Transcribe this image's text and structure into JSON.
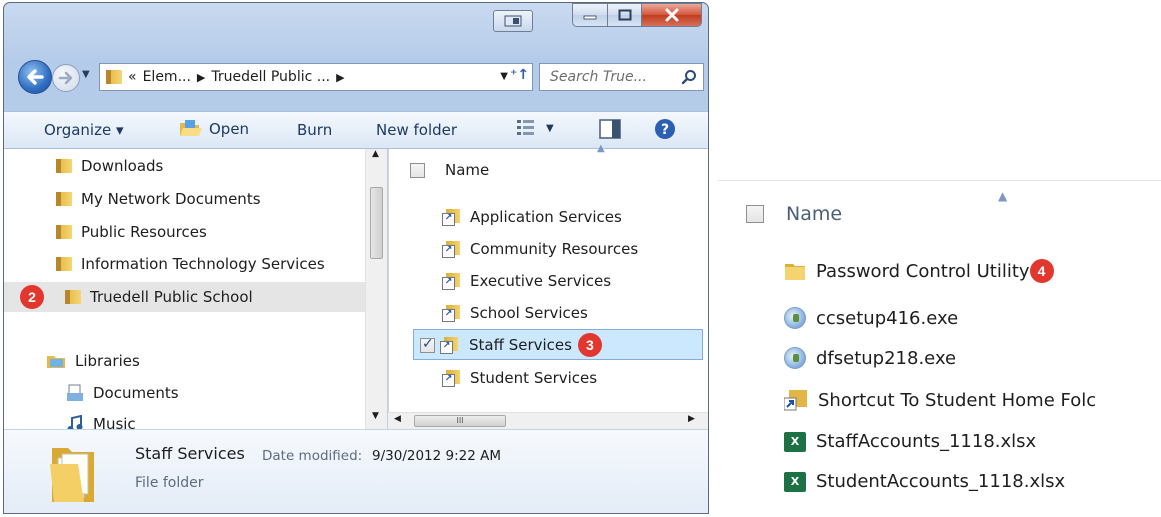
{
  "window": {
    "address_parts": [
      "«",
      "Elem...",
      "Truedell Public ..."
    ],
    "search_placeholder": "Search True..."
  },
  "toolbar": {
    "organize": "Organize ▾",
    "open": "Open",
    "burn": "Burn",
    "new_folder": "New folder"
  },
  "nav_pane": {
    "items": [
      {
        "label": "Downloads"
      },
      {
        "label": "My Network Documents"
      },
      {
        "label": "Public Resources"
      },
      {
        "label": "Information Technology Services"
      },
      {
        "label": "Truedell Public School",
        "badge": "2"
      }
    ],
    "libraries": "Libraries",
    "library_items": [
      {
        "label": "Documents"
      },
      {
        "label": "Music"
      }
    ]
  },
  "file_pane": {
    "column_header": "Name",
    "items": [
      {
        "label": "Application Services"
      },
      {
        "label": "Community Resources"
      },
      {
        "label": "Executive Services"
      },
      {
        "label": "School Services"
      },
      {
        "label": "Staff Services",
        "badge": "3"
      },
      {
        "label": "Student Services"
      }
    ]
  },
  "details": {
    "name": "Staff Services",
    "date_label": "Date modified:",
    "date_value": "9/30/2012 9:22 AM",
    "type": "File folder"
  },
  "zoom_panel": {
    "column_header": "Name",
    "items": [
      {
        "label": "Password Control Utility",
        "icon": "folder-icon",
        "badge": "4"
      },
      {
        "label": "ccsetup416.exe",
        "icon": "installer-icon"
      },
      {
        "label": "dfsetup218.exe",
        "icon": "installer-icon"
      },
      {
        "label": "Shortcut To Student Home Folc",
        "icon": "shortcut-folder-icon"
      },
      {
        "label": "StaffAccounts_1118.xlsx",
        "icon": "excel-icon"
      },
      {
        "label": "StudentAccounts_1118.xlsx",
        "icon": "excel-icon"
      }
    ]
  },
  "colors": {
    "badge": "#e2372e",
    "selection": "#cce8ff",
    "title_bar": "#b9cfea"
  }
}
